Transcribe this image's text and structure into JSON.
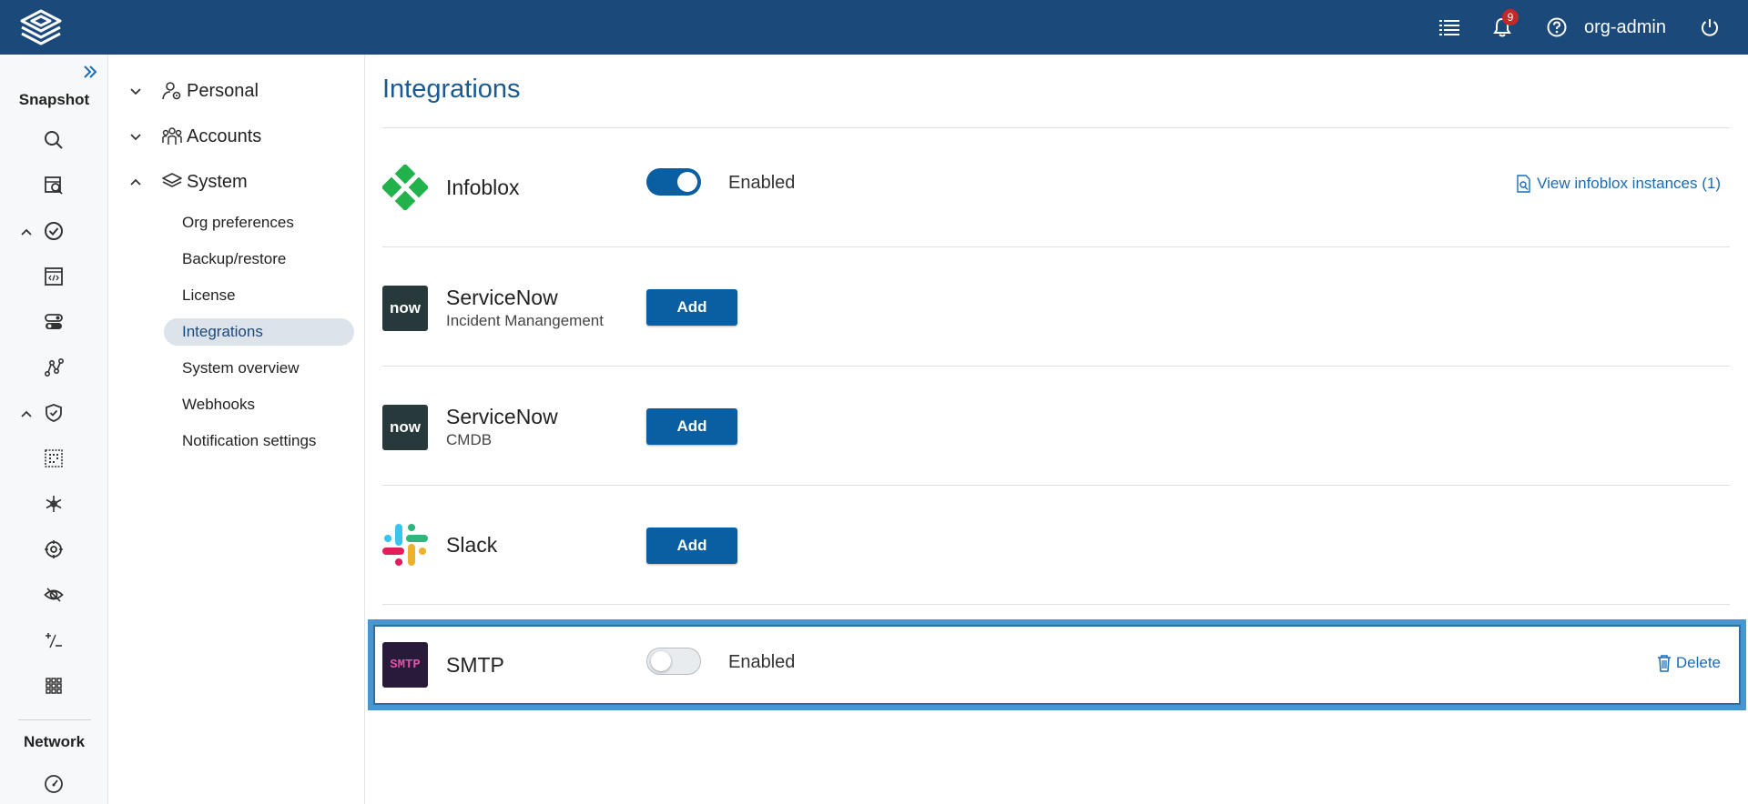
{
  "topbar": {
    "notification_count": "9",
    "user": "org-admin"
  },
  "rail": {
    "section_snapshot": "Snapshot",
    "section_network": "Network"
  },
  "subnav": {
    "groups": [
      {
        "label": "Personal"
      },
      {
        "label": "Accounts"
      },
      {
        "label": "System"
      }
    ],
    "items": [
      {
        "label": "Org preferences"
      },
      {
        "label": "Backup/restore"
      },
      {
        "label": "License"
      },
      {
        "label": "Integrations"
      },
      {
        "label": "System overview"
      },
      {
        "label": "Webhooks"
      },
      {
        "label": "Notification settings"
      }
    ]
  },
  "main": {
    "title": "Integrations",
    "integrations": [
      {
        "name": "Infoblox",
        "sub": "",
        "toggle_label": "Enabled",
        "enabled": true,
        "link": "View infoblox instances (1)"
      },
      {
        "name": "ServiceNow",
        "sub": "Incident Manangement",
        "logo_text": "now",
        "button": "Add"
      },
      {
        "name": "ServiceNow",
        "sub": "CMDB",
        "logo_text": "now",
        "button": "Add"
      },
      {
        "name": "Slack",
        "sub": "",
        "button": "Add"
      },
      {
        "name": "SMTP",
        "sub": "",
        "logo_text": "SMTP",
        "toggle_label": "Enabled",
        "enabled": false,
        "link": "Delete"
      }
    ]
  },
  "colors": {
    "topbar": "#1b4a7a",
    "primary_button": "#0a5fa3",
    "link": "#1b6bb5",
    "selection_border": "#4a96cc"
  }
}
